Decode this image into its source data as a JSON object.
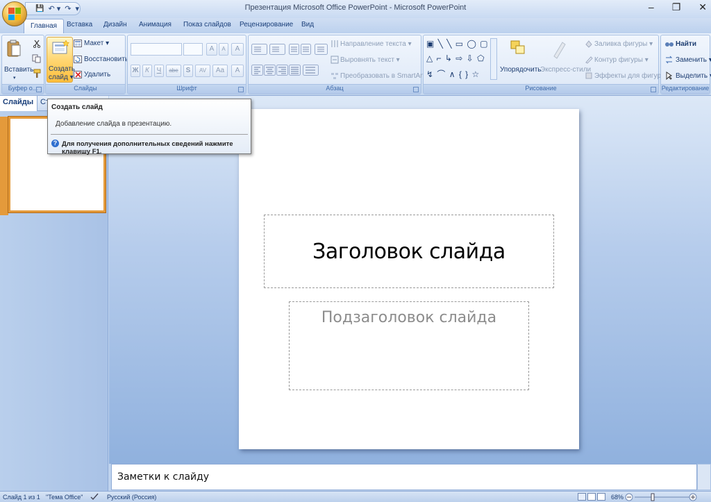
{
  "window": {
    "title": "Презентация Microsoft Office PowerPoint - Microsoft PowerPoint",
    "minimize": "–",
    "restore": "❐",
    "close": "✕"
  },
  "qat": {
    "save": "💾",
    "undo": "↶ ▾",
    "redo": "↷",
    "customize": "▾"
  },
  "tabs": [
    "Главная",
    "Вставка",
    "Дизайн",
    "Анимация",
    "Показ слайдов",
    "Рецензирование",
    "Вид"
  ],
  "ribbon": {
    "clipboard": {
      "label": "Буфер о...",
      "paste": "Вставить",
      "paste_arrow": "▾"
    },
    "slides": {
      "label": "Слайды",
      "new_slide_line1": "Создать",
      "new_slide_line2": "слайд ▾",
      "layout": "Макет ▾",
      "reset": "Восстановить",
      "delete": "Удалить"
    },
    "font": {
      "label": "Шрифт",
      "bold": "Ж",
      "italic": "К",
      "underline": "Ч",
      "strike": "abe",
      "shadow": "S",
      "spacing": "AV",
      "case": "Aa",
      "color": "A",
      "grow": "A",
      "shrink": "A",
      "clear": "A"
    },
    "paragraph": {
      "label": "Абзац",
      "text_direction": "Направление текста ▾",
      "align_text": "Выровнять текст ▾",
      "convert_smartart": "Преобразовать в SmartArt ▾"
    },
    "drawing": {
      "label": "Рисование",
      "arrange": "Упорядочить",
      "quick_styles": "Экспресс-стили",
      "shape_fill": "Заливка фигуры ▾",
      "shape_outline": "Контур фигуры ▾",
      "shape_effects": "Эффекты для фигур ▾",
      "shapes_row1": "▣ ╲ ╲ ▭ ◯ ▢",
      "shapes_row2": "△ ⌐ ↳ ⇨ ⇩ ⬠",
      "shapes_row3": "↯ ⌒ ∧ { } ☆"
    },
    "editing": {
      "label": "Редактирование",
      "find": "Найти",
      "replace": "Заменить ▾",
      "select": "Выделить ▾"
    }
  },
  "left_panel": {
    "tab_slides": "Слайды",
    "tab_outline": "Ст",
    "close": "✕",
    "slide_number": "1"
  },
  "tooltip": {
    "title": "Создать слайд",
    "description": "Добавление слайда в презентацию.",
    "help": "Для получения дополнительных сведений нажмите клавишу F1."
  },
  "slide": {
    "title_placeholder": "Заголовок слайда",
    "subtitle_placeholder": "Подзаголовок слайда"
  },
  "notes": {
    "placeholder": "Заметки к слайду"
  },
  "status": {
    "slide_count": "Слайд 1 из 1",
    "theme": "\"Тема Office\"",
    "language": "Русский (Россия)",
    "zoom": "68%"
  }
}
